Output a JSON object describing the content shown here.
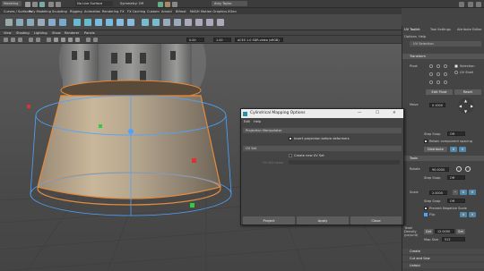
{
  "status_line": {
    "mode_menu": "Modeling",
    "no_live_surface": "No Live Surface",
    "symmetry": "Symmetry: Off",
    "user": "Amy Taylor"
  },
  "shelf_tabs": [
    "Curves / Surfaces",
    "Poly Modeling",
    "Sculpting",
    "Rigging",
    "Animation",
    "Rendering",
    "FX",
    "FX Caching",
    "Custom",
    "Arnold",
    "Bifrost",
    "MASH",
    "Motion Graphics",
    "XGen"
  ],
  "viewport": {
    "menu": [
      "View",
      "Shading",
      "Lighting",
      "Show",
      "Renderer",
      "Panels"
    ],
    "field_a": "0.00",
    "field_b": "1.00",
    "color_space": "ACES 1.0 SDR-video (sRGB)"
  },
  "right_panel": {
    "tabs": [
      "UV Toolkit",
      "Tool Settings",
      "Attribute Editor"
    ],
    "menu": [
      "Options",
      "Help"
    ],
    "subheader": "UV Selection",
    "transform": {
      "title": "Transform",
      "pivot_label": "Pivot",
      "pivot_options": [
        "Selection",
        "UV Shell"
      ],
      "edit_pivot": "Edit Pivot",
      "reset": "Reset",
      "move_label": "Move",
      "move_value": "0.1000",
      "snap_label": "Step Snap",
      "snap_value": "Off",
      "retain_label": "Retain component spacing",
      "distribute_label": "Distribute",
      "tool_label": "Tools"
    },
    "rotate": {
      "label": "Rotate",
      "value": "90.0000",
      "snap_label": "Step Snap",
      "snap_value": "Off"
    },
    "scale": {
      "label": "Scale",
      "value": "2.0000",
      "snap_label": "Step Snap",
      "snap_value": "Off",
      "prevent_label": "Prevent Negative Scale",
      "flip_label": "Flip",
      "u_label": "U",
      "v_label": "V"
    },
    "texel": {
      "label": "Texel Density (px/unit)",
      "get": "Get",
      "value": "12.0000",
      "set": "Set",
      "map_size_label": "Map Size",
      "map_size_value": "512"
    },
    "collapsed_sections": [
      "Create",
      "Cut and Sew",
      "Unfold"
    ]
  },
  "dialog": {
    "title": "Cylindrical Mapping Options",
    "menu": [
      "Edit",
      "Help"
    ],
    "section_projection": "Projection Manipulator",
    "insert_label": "Insert projection before deformers",
    "section_uvset": "UV Set",
    "create_uvset_label": "Create new UV Set",
    "uvset_name_label": "UV Set name",
    "project_button": "Project",
    "apply_button": "Apply",
    "close_button": "Close"
  }
}
